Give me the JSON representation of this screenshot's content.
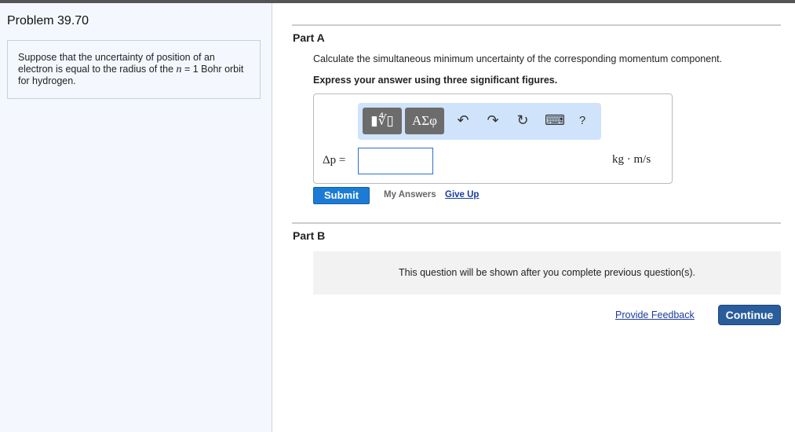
{
  "problem": {
    "title": "Problem 39.70",
    "text_before": "Suppose that the uncertainty of position of an electron is equal to the radius of the ",
    "var": "n",
    "text_after": " = 1 Bohr orbit for hydrogen."
  },
  "partA": {
    "label": "Part A",
    "question": "Calculate the simultaneous minimum uncertainty of the corresponding momentum component.",
    "instruction": "Express your answer using three significant figures.",
    "toolbar": {
      "templates": "▮∜▯",
      "greek": "ΑΣφ",
      "undo": "↶",
      "redo": "↷",
      "reset": "↻",
      "keyboard": "⌨",
      "help": "?"
    },
    "answer_label": "Δp =",
    "answer_value": "",
    "unit": "kg · m/s",
    "submit": "Submit",
    "my_answers": "My Answers",
    "give_up": "Give Up"
  },
  "partB": {
    "label": "Part B",
    "locked_message": "This question will be shown after you complete previous question(s)."
  },
  "footer": {
    "feedback": "Provide Feedback",
    "continue": "Continue"
  }
}
